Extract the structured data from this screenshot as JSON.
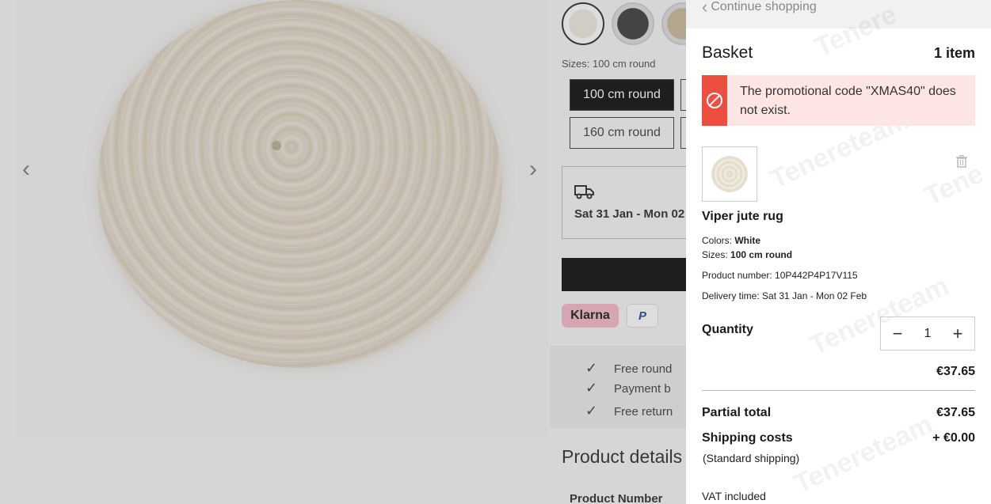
{
  "product_page": {
    "sizes_label": "Sizes: 100 cm round",
    "size_options": [
      "100 cm round",
      "160 cm round"
    ],
    "delivery_text": "Sat 31 Jan - Mon 02",
    "payment_methods": [
      "Klarna",
      "P"
    ],
    "usps": [
      "Free round",
      "Payment b",
      "Free return"
    ],
    "section_title": "Product details",
    "section_subtitle": "Product Number"
  },
  "basket": {
    "continue_label": "Continue shopping",
    "title": "Basket",
    "item_count": "1 item",
    "alert_message": "The promotional code \"XMAS40\" does not exist.",
    "item": {
      "name": "Viper jute rug",
      "colors_label": "Colors:",
      "colors_value": "White",
      "sizes_label": "Sizes:",
      "sizes_value": "100 cm round",
      "product_number": "Product number: 10P442P4P17V115",
      "delivery_time": "Delivery time: Sat 31 Jan - Mon 02 Feb",
      "quantity_label": "Quantity",
      "quantity": "1",
      "price": "€37.65"
    },
    "partial_total_label": "Partial total",
    "partial_total_value": "€37.65",
    "shipping_label": "Shipping costs",
    "shipping_value": "+ €0.00",
    "shipping_note": "(Standard shipping)",
    "vat_note": "VAT included"
  },
  "colors": {
    "alert_bg": "#fde5e4",
    "alert_accent": "#ee4e40",
    "klarna_pink": "#f5b4c6"
  }
}
